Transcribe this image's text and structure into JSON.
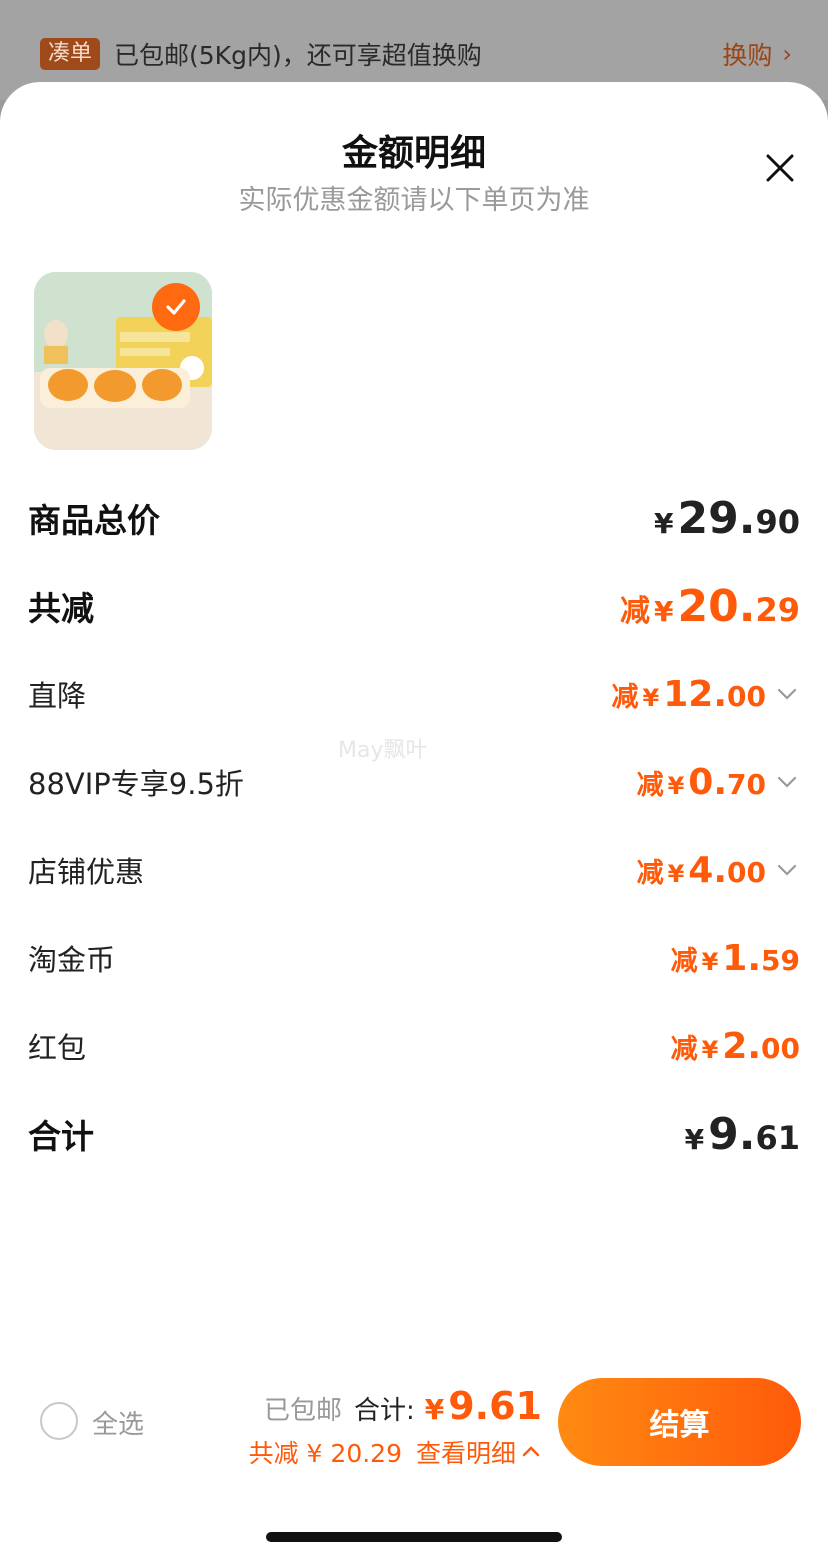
{
  "topbar": {
    "tag": "凑单",
    "message": "已包邮(5Kg内)，还可享超值换购",
    "swap": "换购",
    "swap_chevron": "›"
  },
  "sheet": {
    "title": "金额明细",
    "subtitle": "实际优惠金额请以下单页为准"
  },
  "watermark": "May飘叶",
  "lines": {
    "total_price": {
      "label": "商品总价",
      "yen": "¥",
      "int": "29.",
      "dec": "90"
    },
    "total_discount": {
      "label": "共减",
      "prefix": "减",
      "yen": "¥",
      "int": "20.",
      "dec": "29"
    },
    "direct_drop": {
      "label": "直降",
      "prefix": "减",
      "yen": "¥",
      "int": "12.",
      "dec": "00"
    },
    "vip": {
      "label": "88VIP专享9.5折",
      "prefix": "减",
      "yen": "¥",
      "int": "0.",
      "dec": "70"
    },
    "shop": {
      "label": "店铺优惠",
      "prefix": "减",
      "yen": "¥",
      "int": "4.",
      "dec": "00"
    },
    "coins": {
      "label": "淘金币",
      "prefix": "减",
      "yen": "¥",
      "int": "1.",
      "dec": "59"
    },
    "redpacket": {
      "label": "红包",
      "prefix": "减",
      "yen": "¥",
      "int": "2.",
      "dec": "00"
    },
    "subtotal": {
      "label": "合计",
      "yen": "¥",
      "int": "9.",
      "dec": "61"
    }
  },
  "bottom": {
    "select_all": "全选",
    "shipping": "已包邮",
    "total_label": "合计:",
    "total_yen": "¥",
    "total_value": "9.61",
    "discount_text": "共减 ¥ 20.29",
    "view_detail": "查看明细",
    "view_chevron": "^",
    "checkout": "结算"
  },
  "colors": {
    "accent": "#ff5a0a",
    "accent_light": "#ff8a12",
    "overlay": "#9a9a9a"
  }
}
